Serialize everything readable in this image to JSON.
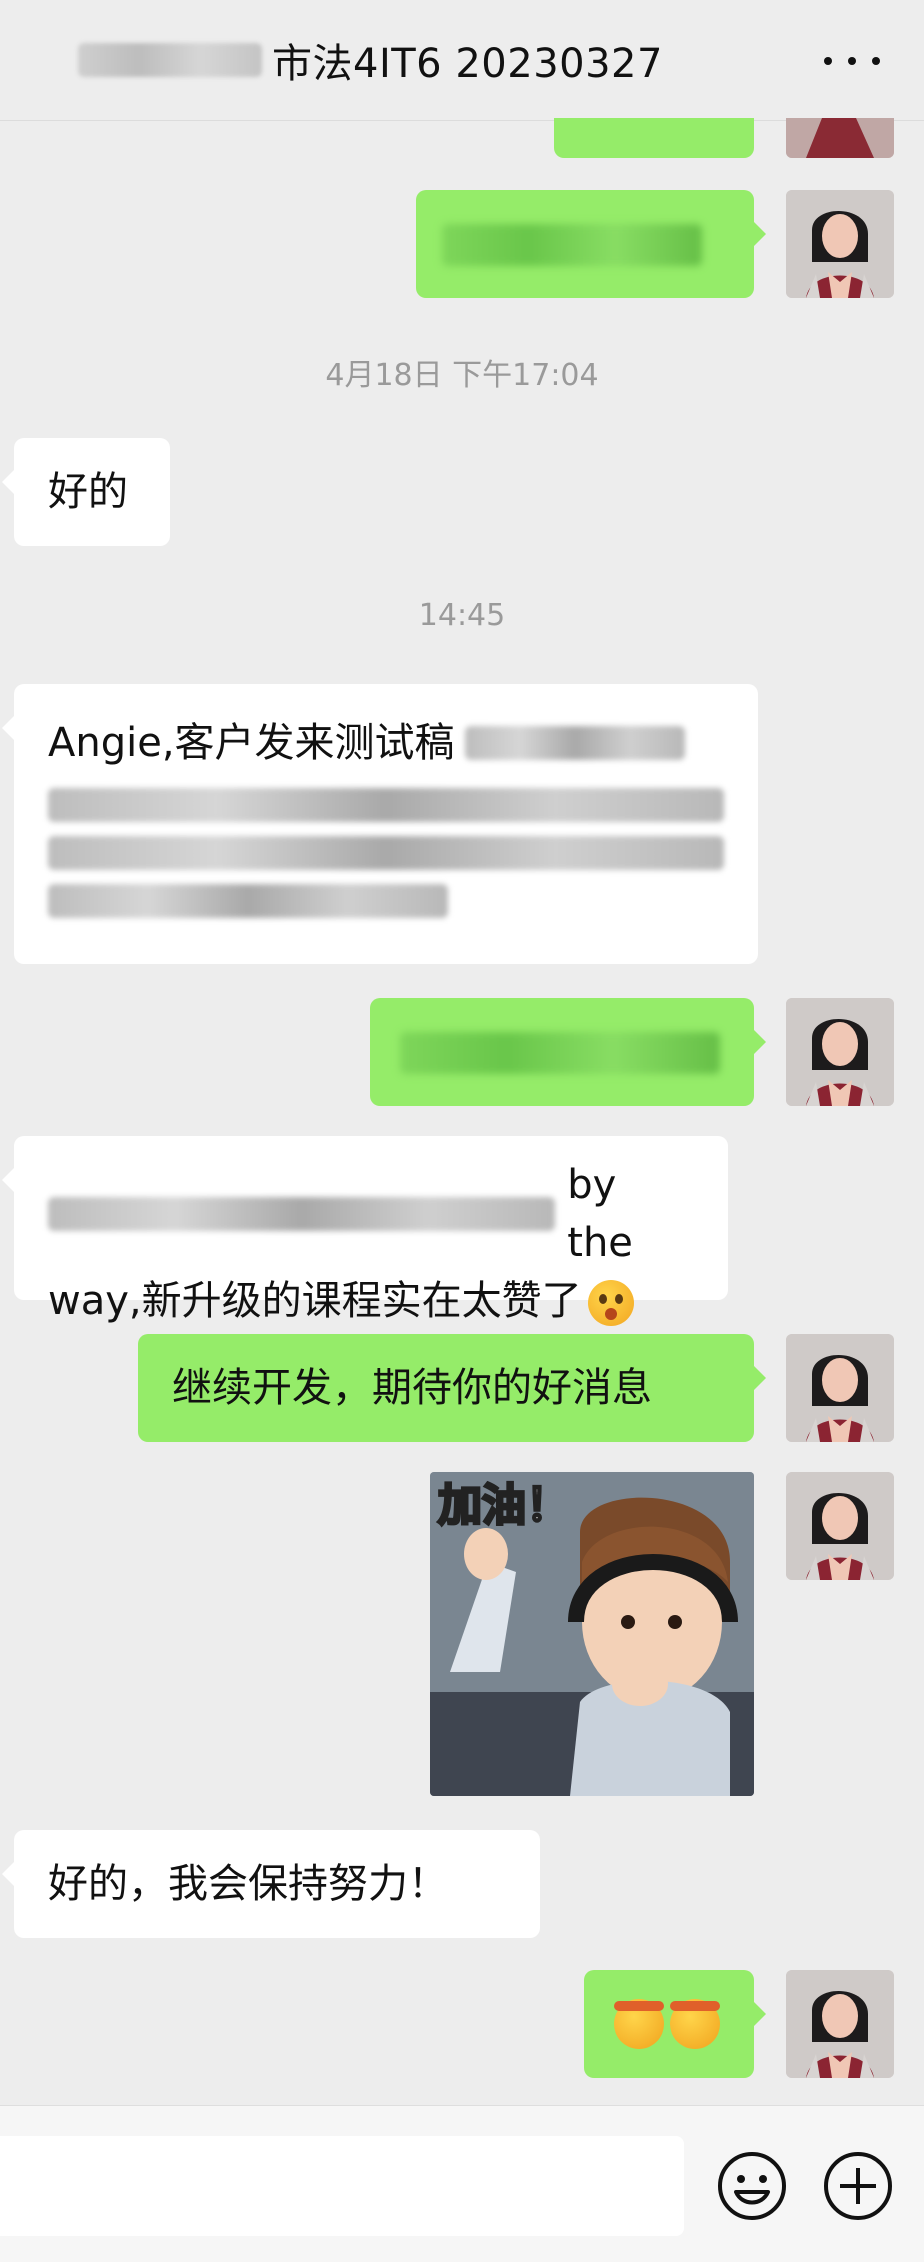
{
  "header": {
    "title": "市法4IT6 20230327",
    "menu_icon": "more-dots-icon"
  },
  "messages": {
    "ts1": "4月18日 下午17:04",
    "m1_text": "好的",
    "ts2": "14:45",
    "m2_text_start": "Angie,客户发来测试稿",
    "m3_text_end_line1": "by the",
    "m3_text_line2": "way,新升级的课程实在太赞了",
    "m4_text": "继续开发，期待你的好消息",
    "sticker_caption": "加油！",
    "m6_text": "好的，我会保持努力！"
  },
  "bottom": {
    "emoji_icon": "smiley-icon",
    "plus_icon": "plus-circle-icon"
  },
  "colors": {
    "bg": "#ededed",
    "green_bubble": "#95ec69",
    "white_bubble": "#ffffff",
    "timestamp": "#9a9a9a"
  }
}
